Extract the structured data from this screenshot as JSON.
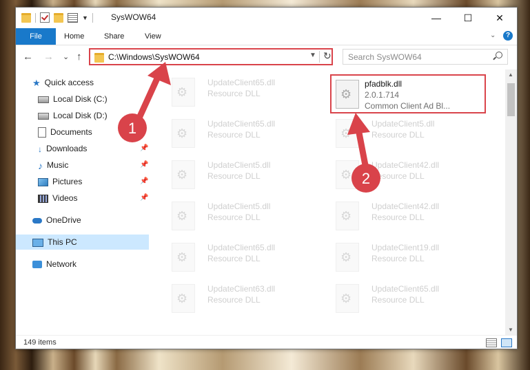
{
  "window": {
    "title": "SysWOW64",
    "minimize_glyph": "—",
    "maximize_glyph": "☐",
    "close_glyph": "✕"
  },
  "ribbon": {
    "tabs": [
      "File",
      "Home",
      "Share",
      "View"
    ],
    "help_glyph": "?"
  },
  "nav": {
    "back_glyph": "←",
    "forward_glyph": "→",
    "recent_glyph": "⌄",
    "up_glyph": "↑",
    "address": "C:\\Windows\\SysWOW64",
    "refresh_glyph": "↻",
    "search_placeholder": "Search SysWOW64"
  },
  "sidebar": {
    "items": [
      {
        "label": "Quick access",
        "icon": "star-icon"
      },
      {
        "label": "Local Disk (C:)",
        "icon": "disk-icon"
      },
      {
        "label": "Local Disk (D:)",
        "icon": "disk-icon"
      },
      {
        "label": "Documents",
        "icon": "documents-icon"
      },
      {
        "label": "Downloads",
        "icon": "downloads-icon"
      },
      {
        "label": "Music",
        "icon": "music-icon"
      },
      {
        "label": "Pictures",
        "icon": "pictures-icon"
      },
      {
        "label": "Videos",
        "icon": "videos-icon"
      },
      {
        "label": "OneDrive",
        "icon": "onedrive-icon"
      },
      {
        "label": "This PC",
        "icon": "this-pc-icon"
      },
      {
        "label": "Network",
        "icon": "network-icon"
      }
    ]
  },
  "files": {
    "highlighted": {
      "name": "pfadblk.dll",
      "version": "2.0.1.714",
      "description": "Common Client Ad Bl..."
    },
    "faded": [
      {
        "name": "UpdateClient65.dll",
        "type": "Resource DLL"
      },
      {
        "name": "UpdateClient65.dll",
        "type": "Resource DLL"
      },
      {
        "name": "UpdateClient5.dll",
        "type": "Resource DLL"
      },
      {
        "name": "UpdateClient5.dll",
        "type": "Resource DLL"
      },
      {
        "name": "UpdateClient65.dll",
        "type": "Resource DLL"
      },
      {
        "name": "UpdateClient63.dll",
        "type": "Resource DLL"
      },
      {
        "name": "UpdateClient5.dll",
        "type": "Resource DLL"
      },
      {
        "name": "UpdateClient42.dll",
        "type": "Resource DLL"
      },
      {
        "name": "UpdateClient42.dll",
        "type": "Resource DLL"
      },
      {
        "name": "UpdateClient19.dll",
        "type": "Resource DLL"
      },
      {
        "name": "UpdateClient65.dll",
        "type": "Resource DLL"
      }
    ]
  },
  "status": {
    "item_count": "149 items"
  },
  "annotations": {
    "marker_1": "1",
    "marker_2": "2",
    "color": "#d9434a"
  }
}
